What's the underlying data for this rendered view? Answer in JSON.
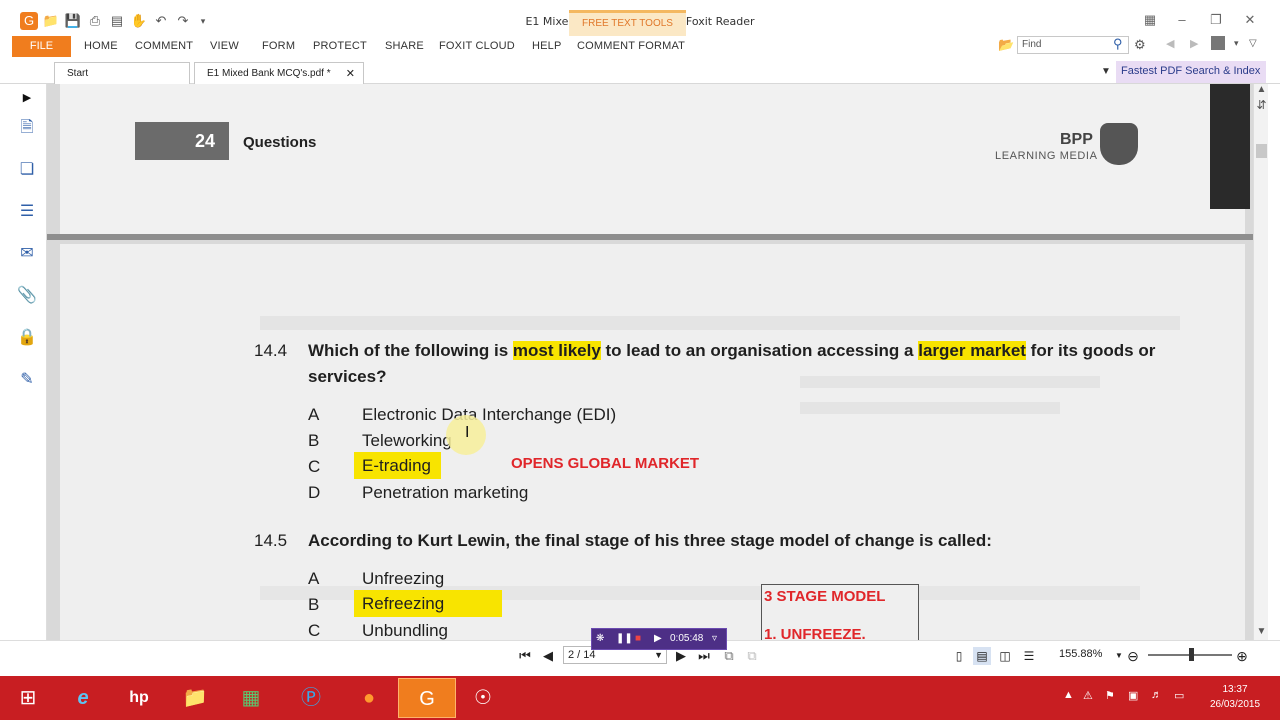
{
  "app": {
    "window_title": "E1 Mixed Bank MCQ's.pdf * - Foxit Reader",
    "context_tab": "FREE TEXT TOOLS"
  },
  "ribbon": {
    "file": "FILE",
    "tabs": [
      "HOME",
      "COMMENT",
      "VIEW",
      "FORM",
      "PROTECT",
      "SHARE",
      "FOXIT CLOUD",
      "HELP",
      "COMMENT FORMAT"
    ],
    "find_placeholder": "Find"
  },
  "doc_tabs": [
    {
      "label": "Start"
    },
    {
      "label": "E1 Mixed Bank MCQ's.pdf *"
    }
  ],
  "promo": {
    "fastest_search": "Fastest PDF Search & Index"
  },
  "page_header": {
    "page_number": "24",
    "section": "Questions",
    "brand": "BPP",
    "brand_sub": "LEARNING MEDIA"
  },
  "q14_4": {
    "num": "14.4",
    "text_part1": "Which of the following is ",
    "hl1": "most likely",
    "text_part2": " to lead to an organisation accessing a ",
    "hl2": "larger market",
    "text_part3": " for its goods or",
    "text_line2": "services?",
    "options": [
      {
        "letter": "A",
        "text": "Electronic Data Interchange (EDI)"
      },
      {
        "letter": "B",
        "text": "Teleworking"
      },
      {
        "letter": "C",
        "text": "E-trading"
      },
      {
        "letter": "D",
        "text": "Penetration marketing"
      }
    ],
    "note": "OPENS GLOBAL MARKET"
  },
  "q14_5": {
    "num": "14.5",
    "text": "According to Kurt Lewin, the final stage of his three stage model of change is called:",
    "options": [
      {
        "letter": "A",
        "text": "Unfreezing"
      },
      {
        "letter": "B",
        "text": "Refreezing"
      },
      {
        "letter": "C",
        "text": "Unbundling"
      }
    ],
    "note_box": {
      "line1": "3 STAGE MODEL",
      "line2": "1. UNFREEZE."
    }
  },
  "statusbar": {
    "page_indicator": "2 / 14",
    "zoom": "155.88%",
    "recorder_time": "0:05:48"
  },
  "taskbar": {
    "time": "13:37",
    "date": "26/03/2015"
  }
}
